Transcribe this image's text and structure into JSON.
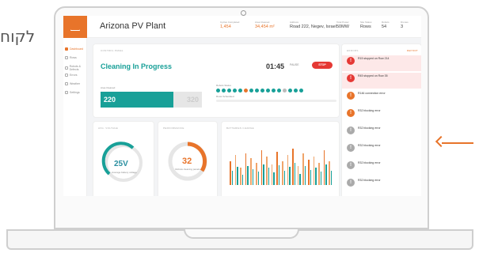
{
  "side_text": "לקוח",
  "app": {
    "title": "Arizona  PV Plant"
  },
  "nav": [
    {
      "label": "Dashboard",
      "active": true
    },
    {
      "label": "Rows",
      "active": false
    },
    {
      "label": "Robots & Defects",
      "active": false
    },
    {
      "label": "Errors",
      "active": false
    },
    {
      "label": "Weather",
      "active": false
    },
    {
      "label": "Settings",
      "active": false
    }
  ],
  "stats": [
    {
      "label": "Cycles Completed",
      "value": "1,454"
    },
    {
      "label": "Area Cleaned",
      "value": "34,454 m²"
    },
    {
      "label": "Address",
      "value": "Road 222, Negev, Israel"
    },
    {
      "label": "Total Power",
      "value": "50MW"
    },
    {
      "label": "Site Status",
      "value": "Rows"
    },
    {
      "label": "Robots",
      "value": "54"
    },
    {
      "label": "Drones",
      "value": "3"
    }
  ],
  "control": {
    "panel_title": "CONTROL PANEL",
    "status": "Cleaning In Progress",
    "time": "01:45",
    "pause_label": "PAUSE",
    "stop_label": "STOP",
    "area_label": "Area Cleaned",
    "area_value": "220",
    "area_total": "320",
    "area_unit": "m²",
    "robots_label": "Robots Status",
    "rows_label": "Rows Scheduled"
  },
  "voltage": {
    "title": "AVG. VOLTAGE",
    "value": "25V",
    "caption": "Average battery voltage"
  },
  "performance": {
    "title": "PERFORMANCE",
    "value": "32",
    "caption": "Robots cleaning panels"
  },
  "battery_chart": {
    "title": "BATTERIES CHARGE"
  },
  "errors": {
    "title": "ERRORS",
    "report_label": "REPORT",
    "items": [
      {
        "badge": "!",
        "text": "R15 stopped on Row 214",
        "color": "#e53935",
        "highlight": true
      },
      {
        "badge": "!",
        "text": "R45 stopped on Row 35",
        "color": "#e53935",
        "highlight": true
      },
      {
        "badge": "!",
        "text": "R146 connection error",
        "color": "#e8742a",
        "highlight": false
      },
      {
        "badge": "!",
        "text": "R32 blocking error",
        "color": "#e8742a",
        "highlight": false
      },
      {
        "badge": "!",
        "text": "R32 blocking error",
        "color": "#aaaaaa",
        "highlight": false
      },
      {
        "badge": "!",
        "text": "R32 blocking error",
        "color": "#aaaaaa",
        "highlight": false
      },
      {
        "badge": "!",
        "text": "R32 blocking error",
        "color": "#aaaaaa",
        "highlight": false
      },
      {
        "badge": "!",
        "text": "R32 blocking error",
        "color": "#aaaaaa",
        "highlight": false
      }
    ]
  },
  "colors": {
    "accent": "#e8742a",
    "teal": "#18a098",
    "alert": "#e53935"
  }
}
